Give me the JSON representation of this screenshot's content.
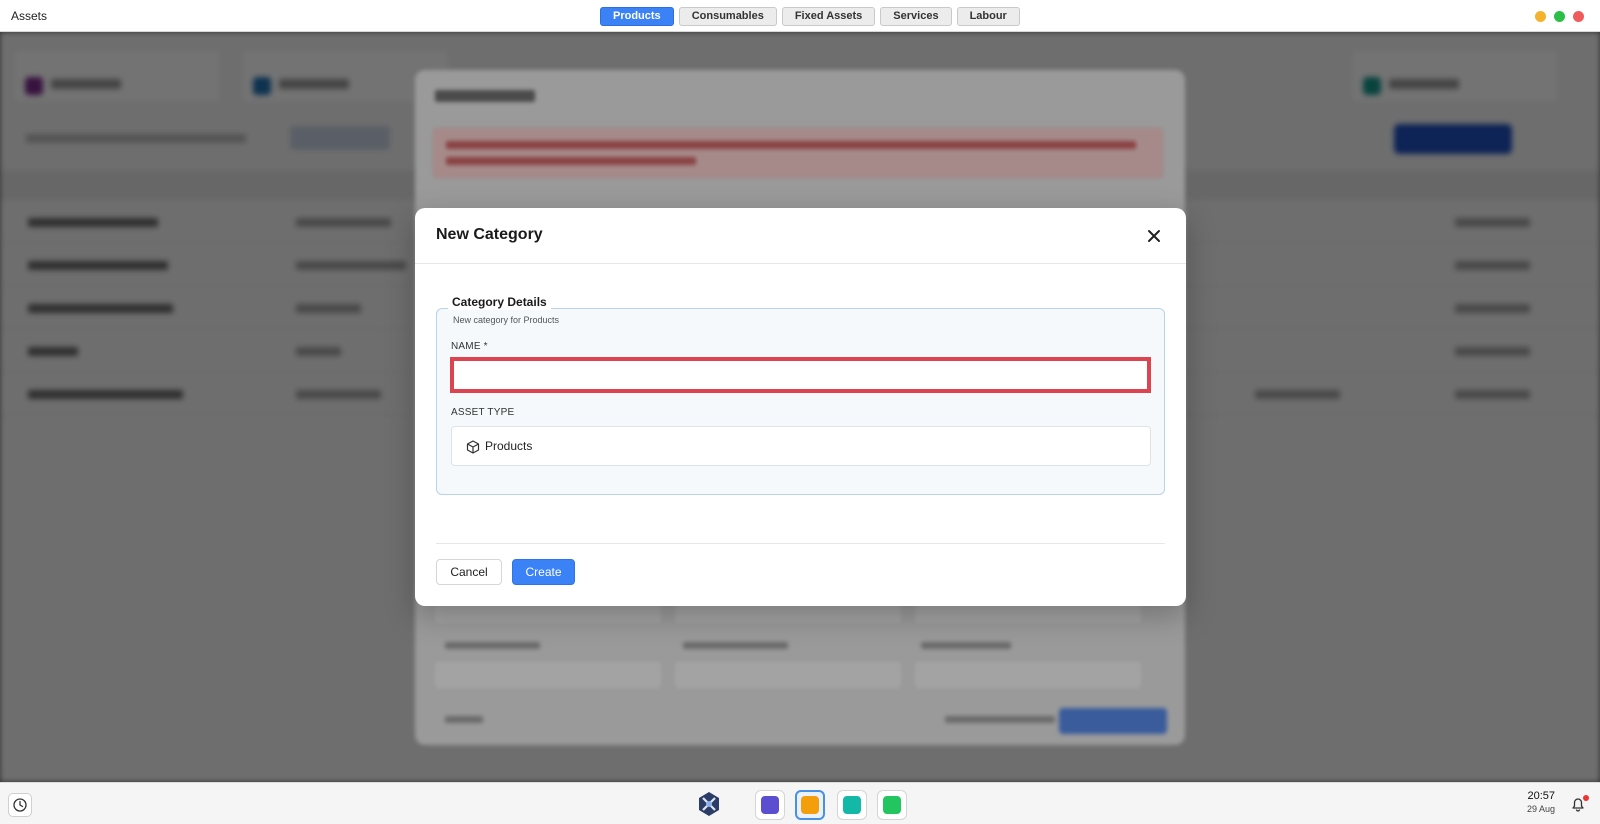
{
  "window": {
    "title": "Assets",
    "controls": {
      "minimize_color": "#f5b22c",
      "maximize_color": "#2bbf47",
      "close_color": "#ef5b5b"
    }
  },
  "tabs": [
    {
      "label": "Products",
      "active": true
    },
    {
      "label": "Consumables",
      "active": false
    },
    {
      "label": "Fixed Assets",
      "active": false
    },
    {
      "label": "Services",
      "active": false
    },
    {
      "label": "Labour",
      "active": false
    }
  ],
  "modal": {
    "title": "New Category",
    "close_icon": "close-icon",
    "section": {
      "title": "Category Details",
      "subtitle": "New category for Products"
    },
    "name_field": {
      "label": "NAME *",
      "value": "",
      "placeholder": ""
    },
    "asset_type": {
      "label": "ASSET TYPE",
      "value": "Products",
      "icon": "box-icon"
    },
    "buttons": {
      "cancel": "Cancel",
      "create": "Create"
    },
    "colors": {
      "primary": "#3b82f6",
      "highlight": "#dc4550"
    }
  },
  "taskbar": {
    "time": "20:57",
    "date": "29 Aug",
    "apps": [
      {
        "name": "logo",
        "active": false
      },
      {
        "name": "contacts",
        "active": false,
        "color": "#5b4ed1"
      },
      {
        "name": "assets",
        "active": true,
        "color": "#f59e0b"
      },
      {
        "name": "sales",
        "active": false,
        "color": "#14b8a6"
      },
      {
        "name": "notes",
        "active": false,
        "color": "#22c55e"
      }
    ]
  }
}
